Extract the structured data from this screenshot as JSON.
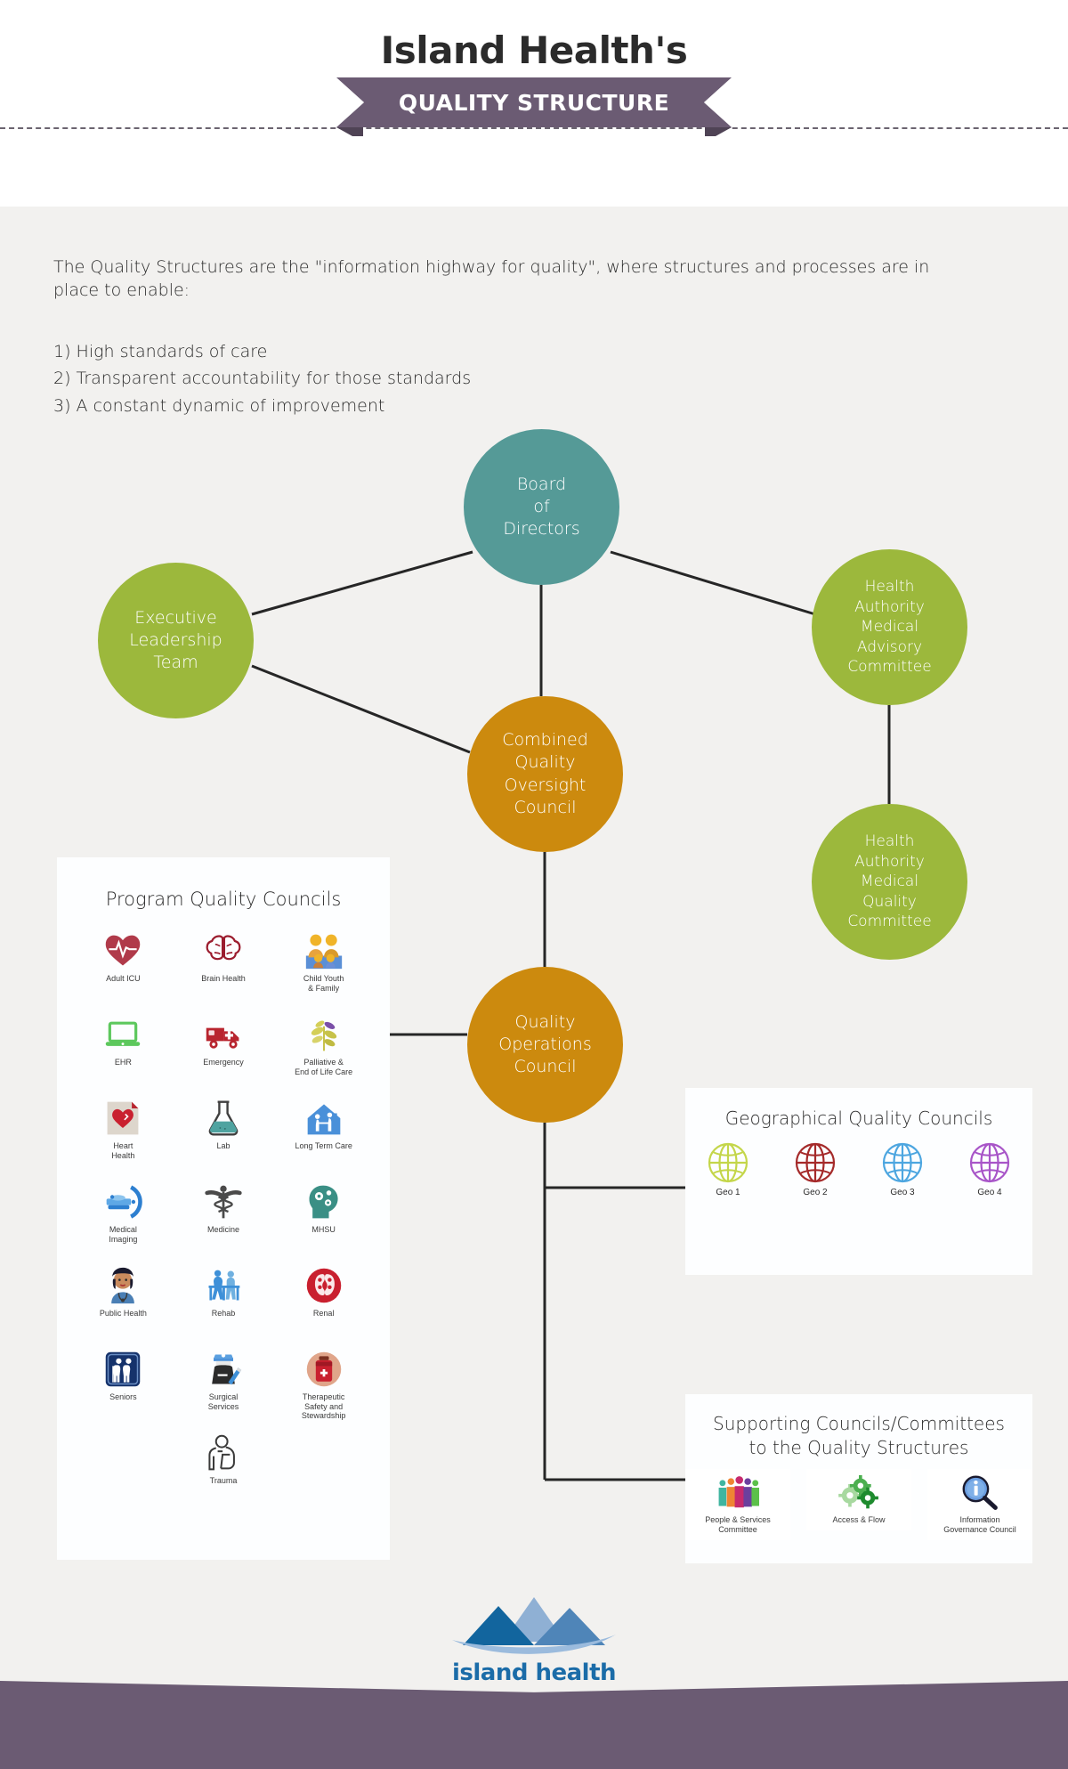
{
  "header": {
    "title": "Island Health's",
    "ribbon_label": "QUALITY STRUCTURE",
    "ribbon_color": "#6b5b73"
  },
  "intro": {
    "paragraph": "The Quality Structures are the \"information highway for quality\", where structures and processes are in place to enable:",
    "list": [
      "1) High standards of care",
      "2) Transparent accountability for those standards",
      "3) A constant dynamic of improvement"
    ]
  },
  "chart_data": {
    "type": "diagram",
    "title": "Island Health's Quality Structure",
    "nodes": [
      {
        "id": "board",
        "label": "Board\nof\nDirectors",
        "color": "#559a97"
      },
      {
        "id": "elt",
        "label": "Executive\nLeadership\nTeam",
        "color": "#9cb83c"
      },
      {
        "id": "hamac",
        "label": "Health\nAuthority\nMedical\nAdvisory\nCommittee",
        "color": "#9cb83c"
      },
      {
        "id": "hamqc",
        "label": "Health\nAuthority\nMedical\nQuality\nCommittee",
        "color": "#9cb83c"
      },
      {
        "id": "cqoc",
        "label": "Combined\nQuality\nOversight\nCouncil",
        "color": "#cc8a0e"
      },
      {
        "id": "qoc",
        "label": "Quality\nOperations\nCouncil",
        "color": "#cc8a0e"
      }
    ],
    "edges": [
      [
        "board",
        "elt"
      ],
      [
        "board",
        "hamac"
      ],
      [
        "board",
        "cqoc"
      ],
      [
        "elt",
        "cqoc"
      ],
      [
        "hamac",
        "hamqc"
      ],
      [
        "cqoc",
        "qoc"
      ],
      [
        "qoc",
        "program_quality_councils"
      ],
      [
        "qoc",
        "geographical_quality_councils"
      ],
      [
        "qoc",
        "supporting_councils"
      ]
    ]
  },
  "nodes": {
    "board": {
      "line1": "Board",
      "line2": "of",
      "line3": "Directors"
    },
    "elt": {
      "line1": "Executive",
      "line2": "Leadership",
      "line3": "Team"
    },
    "hamac": {
      "line1": "Health",
      "line2": "Authority",
      "line3": "Medical",
      "line4": "Advisory",
      "line5": "Committee"
    },
    "hamqc": {
      "line1": "Health",
      "line2": "Authority",
      "line3": "Medical",
      "line4": "Quality",
      "line5": "Committee"
    },
    "cqoc": {
      "line1": "Combined",
      "line2": "Quality",
      "line3": "Oversight",
      "line4": "Council"
    },
    "qoc": {
      "line1": "Quality",
      "line2": "Operations",
      "line3": "Council"
    }
  },
  "program_quality_councils": {
    "title": "Program Quality Councils",
    "items": [
      {
        "label": "Adult ICU",
        "icon": "heart-pulse-icon"
      },
      {
        "label": "Brain Health",
        "icon": "brain-icon"
      },
      {
        "label": "Child Youth\n& Family",
        "icon": "family-icon"
      },
      {
        "label": "EHR",
        "icon": "laptop-icon"
      },
      {
        "label": "Emergency",
        "icon": "ambulance-icon"
      },
      {
        "label": "Palliative &\nEnd of Life Care",
        "icon": "leaf-branch-icon"
      },
      {
        "label": "Heart\nHealth",
        "icon": "heart-note-icon"
      },
      {
        "label": "Lab",
        "icon": "flask-icon"
      },
      {
        "label": "Long Term Care",
        "icon": "house-care-icon"
      },
      {
        "label": "Medical\nImaging",
        "icon": "mri-scanner-icon"
      },
      {
        "label": "Medicine",
        "icon": "caduceus-icon"
      },
      {
        "label": "MHSU",
        "icon": "head-gears-icon"
      },
      {
        "label": "Public Health",
        "icon": "nurse-icon"
      },
      {
        "label": "Rehab",
        "icon": "rehab-walking-icon"
      },
      {
        "label": "Renal",
        "icon": "kidney-icon"
      },
      {
        "label": "Seniors",
        "icon": "seniors-sign-icon"
      },
      {
        "label": "Surgical\nServices",
        "icon": "surgeon-icon"
      },
      {
        "label": "Therapeutic\nSafety and\nStewardship",
        "icon": "medicine-bottle-icon"
      }
    ],
    "last_item": {
      "label": "Trauma",
      "icon": "arm-sling-icon"
    }
  },
  "geographical_quality_councils": {
    "title": "Geographical Quality Councils",
    "items": [
      {
        "label": "Geo 1",
        "icon": "globe-icon",
        "color": "#c4d64a"
      },
      {
        "label": "Geo 2",
        "icon": "globe-icon",
        "color": "#a52a2a"
      },
      {
        "label": "Geo 3",
        "icon": "globe-icon",
        "color": "#4da6e0"
      },
      {
        "label": "Geo 4",
        "icon": "globe-icon",
        "color": "#a855c8"
      }
    ]
  },
  "supporting_councils": {
    "title_line1": "Supporting Councils/Committees",
    "title_line2": "to the Quality Structures",
    "items": [
      {
        "label": "People & Services\nCommittee",
        "icon": "people-group-icon"
      },
      {
        "label": "Access & Flow",
        "icon": "gears-icon"
      },
      {
        "label": "Information\nGovernance Council",
        "icon": "magnifier-info-icon"
      }
    ]
  },
  "footer": {
    "logo_text": "island health",
    "logo_color": "#1b6ca8",
    "band_color": "#6b5b73"
  }
}
